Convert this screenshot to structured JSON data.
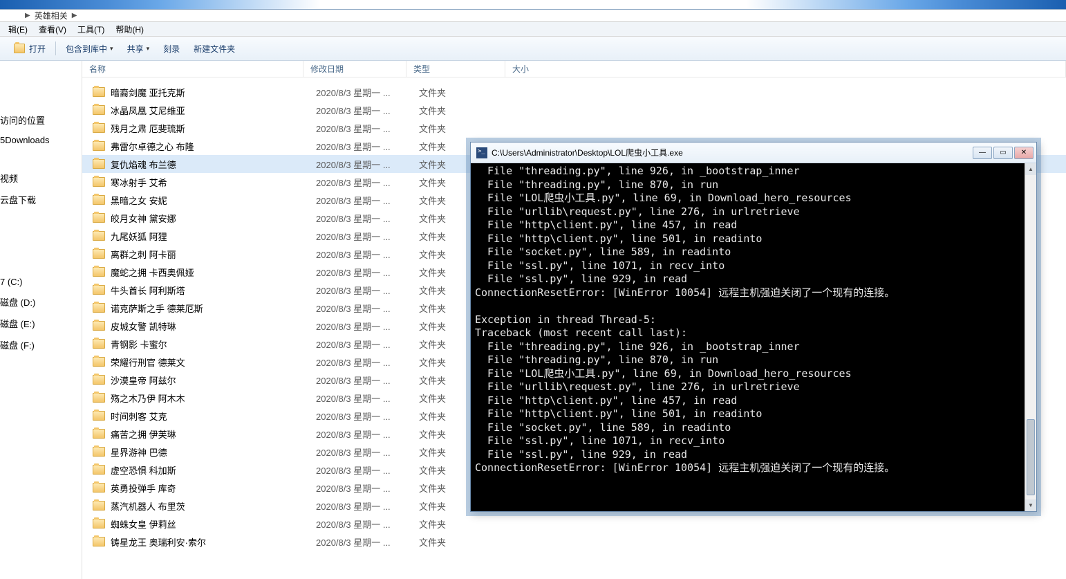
{
  "address": {
    "folder": "英雄相关"
  },
  "menus": {
    "edit": "辑(E)",
    "view": "查看(V)",
    "tools": "工具(T)",
    "help": "帮助(H)"
  },
  "toolbar": {
    "open": "打开",
    "include": "包含到库中",
    "share": "共享",
    "burn": "刻录",
    "newfolder": "新建文件夹"
  },
  "sidebar": {
    "visited": "访问的位置",
    "downloads": "5Downloads",
    "video": "视频",
    "cloud": "云盘下载",
    "disk_c": "7 (C:)",
    "disk_d": "磁盘 (D:)",
    "disk_e": "磁盘 (E:)",
    "disk_f": "磁盘 (F:)"
  },
  "headers": {
    "name": "名称",
    "date": "修改日期",
    "type": "类型",
    "size": "大小"
  },
  "files": [
    {
      "name": "暗裔剑魔 亚托克斯",
      "date": "2020/8/3 星期一 ...",
      "type": "文件夹"
    },
    {
      "name": "冰晶凤凰 艾尼维亚",
      "date": "2020/8/3 星期一 ...",
      "type": "文件夹"
    },
    {
      "name": "残月之肃 厄斐琉斯",
      "date": "2020/8/3 星期一 ...",
      "type": "文件夹"
    },
    {
      "name": "弗雷尔卓德之心 布隆",
      "date": "2020/8/3 星期一 ...",
      "type": "文件夹"
    },
    {
      "name": "复仇焰魂 布兰德",
      "date": "2020/8/3 星期一 ...",
      "type": "文件夹",
      "selected": true
    },
    {
      "name": "寒冰射手 艾希",
      "date": "2020/8/3 星期一 ...",
      "type": "文件夹"
    },
    {
      "name": "黑暗之女 安妮",
      "date": "2020/8/3 星期一 ...",
      "type": "文件夹"
    },
    {
      "name": "皎月女神 黛安娜",
      "date": "2020/8/3 星期一 ...",
      "type": "文件夹"
    },
    {
      "name": "九尾妖狐 阿狸",
      "date": "2020/8/3 星期一 ...",
      "type": "文件夹"
    },
    {
      "name": "离群之刺 阿卡丽",
      "date": "2020/8/3 星期一 ...",
      "type": "文件夹"
    },
    {
      "name": "魔蛇之拥 卡西奥佩娅",
      "date": "2020/8/3 星期一 ...",
      "type": "文件夹"
    },
    {
      "name": "牛头酋长 阿利斯塔",
      "date": "2020/8/3 星期一 ...",
      "type": "文件夹"
    },
    {
      "name": "诺克萨斯之手 德莱厄斯",
      "date": "2020/8/3 星期一 ...",
      "type": "文件夹"
    },
    {
      "name": "皮城女警 凯特琳",
      "date": "2020/8/3 星期一 ...",
      "type": "文件夹"
    },
    {
      "name": "青钢影 卡蜜尔",
      "date": "2020/8/3 星期一 ...",
      "type": "文件夹"
    },
    {
      "name": "荣耀行刑官 德莱文",
      "date": "2020/8/3 星期一 ...",
      "type": "文件夹"
    },
    {
      "name": "沙漠皇帝 阿兹尔",
      "date": "2020/8/3 星期一 ...",
      "type": "文件夹"
    },
    {
      "name": "殇之木乃伊 阿木木",
      "date": "2020/8/3 星期一 ...",
      "type": "文件夹"
    },
    {
      "name": "时间刺客 艾克",
      "date": "2020/8/3 星期一 ...",
      "type": "文件夹"
    },
    {
      "name": "痛苦之拥 伊芙琳",
      "date": "2020/8/3 星期一 ...",
      "type": "文件夹"
    },
    {
      "name": "星界游神 巴德",
      "date": "2020/8/3 星期一 ...",
      "type": "文件夹"
    },
    {
      "name": "虚空恐惧 科加斯",
      "date": "2020/8/3 星期一 ...",
      "type": "文件夹"
    },
    {
      "name": "英勇投弹手 库奇",
      "date": "2020/8/3 星期一 ...",
      "type": "文件夹"
    },
    {
      "name": "蒸汽机器人 布里茨",
      "date": "2020/8/3 星期一 ...",
      "type": "文件夹"
    },
    {
      "name": "蜘蛛女皇 伊莉丝",
      "date": "2020/8/3 星期一 ...",
      "type": "文件夹"
    },
    {
      "name": "铸星龙王 奥瑞利安·索尔",
      "date": "2020/8/3 星期一 ...",
      "type": "文件夹"
    }
  ],
  "console": {
    "title": "C:\\Users\\Administrator\\Desktop\\LOL爬虫小工具.exe",
    "lines": [
      "  File \"threading.py\", line 926, in _bootstrap_inner",
      "  File \"threading.py\", line 870, in run",
      "  File \"LOL爬虫小工具.py\", line 69, in Download_hero_resources",
      "  File \"urllib\\request.py\", line 276, in urlretrieve",
      "  File \"http\\client.py\", line 457, in read",
      "  File \"http\\client.py\", line 501, in readinto",
      "  File \"socket.py\", line 589, in readinto",
      "  File \"ssl.py\", line 1071, in recv_into",
      "  File \"ssl.py\", line 929, in read",
      "ConnectionResetError: [WinError 10054] 远程主机强迫关闭了一个现有的连接。",
      "",
      "Exception in thread Thread-5:",
      "Traceback (most recent call last):",
      "  File \"threading.py\", line 926, in _bootstrap_inner",
      "  File \"threading.py\", line 870, in run",
      "  File \"LOL爬虫小工具.py\", line 69, in Download_hero_resources",
      "  File \"urllib\\request.py\", line 276, in urlretrieve",
      "  File \"http\\client.py\", line 457, in read",
      "  File \"http\\client.py\", line 501, in readinto",
      "  File \"socket.py\", line 589, in readinto",
      "  File \"ssl.py\", line 1071, in recv_into",
      "  File \"ssl.py\", line 929, in read",
      "ConnectionResetError: [WinError 10054] 远程主机强迫关闭了一个现有的连接。"
    ]
  }
}
